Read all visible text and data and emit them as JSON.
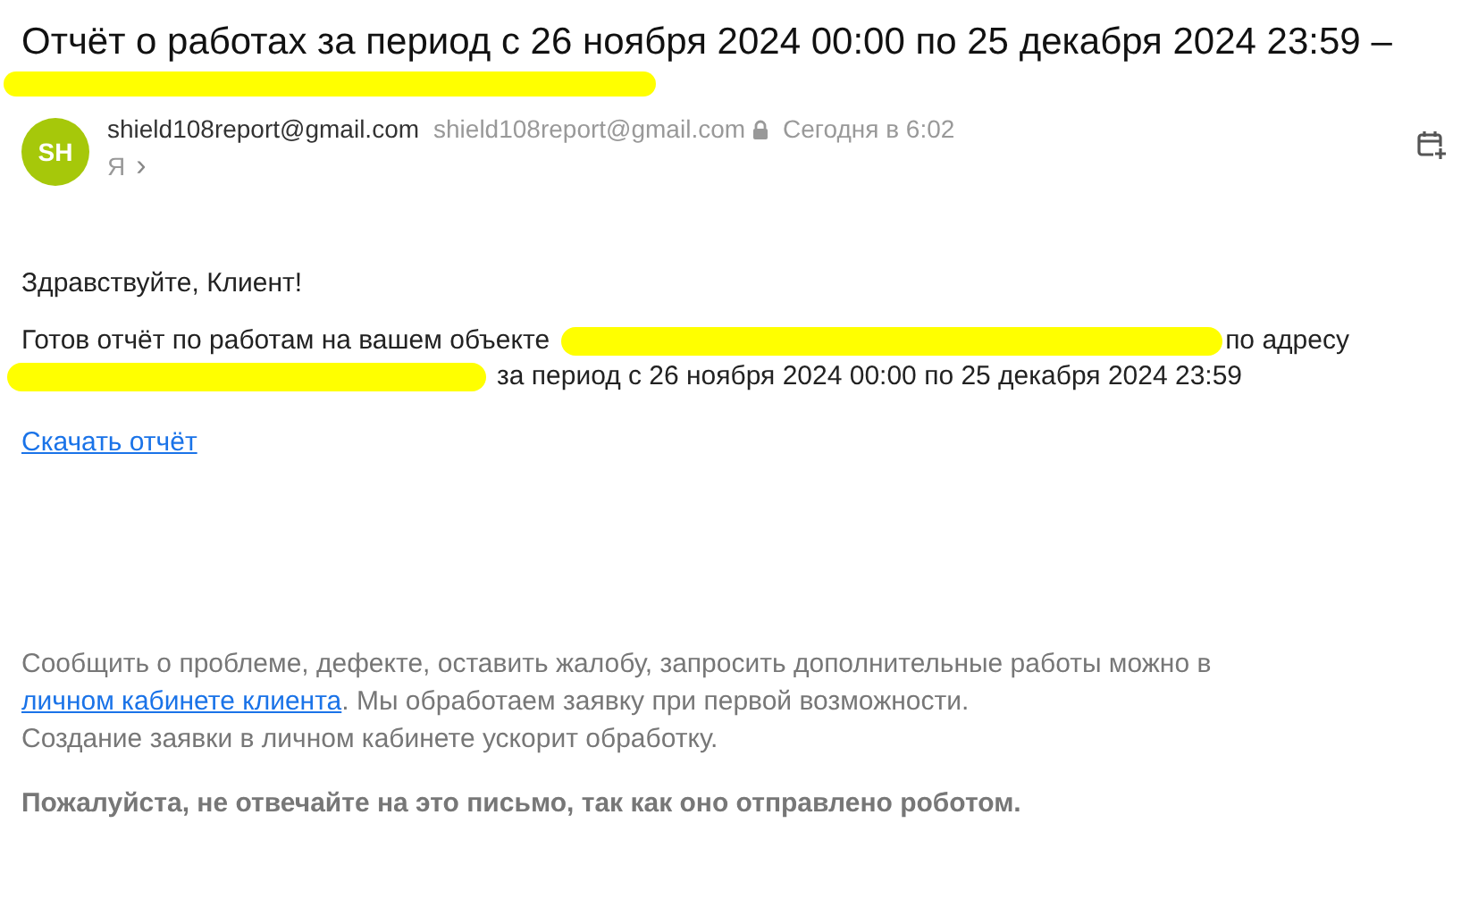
{
  "subject": {
    "text": "Отчёт о работах за период с 26 ноября 2024 00:00 по 25 декабря 2024 23:59 –",
    "redacted_line": true
  },
  "sender": {
    "initials": "SH",
    "name": "shield108report@gmail.com",
    "address": "shield108report@gmail.com",
    "locked": true,
    "time": "Сегодня в 6:02",
    "recipient": "Я",
    "recipient_arrow": "›"
  },
  "body": {
    "greeting": "Здравствуйте, Клиент!",
    "lines": [
      [
        {
          "kind": "text",
          "text": "Готов отчёт по работам на вашем объекте"
        },
        {
          "kind": "redaction"
        },
        {
          "kind": "text",
          "text": "по адресу"
        }
      ],
      [
        {
          "kind": "redaction"
        },
        {
          "kind": "text",
          "text": "за период с 26 ноября 2024 00:00 по 25 декабря 2024 23:59"
        }
      ]
    ],
    "download_link": "Скачать отчёт"
  },
  "footer": {
    "before": "Сообщить о проблеме, дефекте, оставить жалобу, запросить дополнительные работы можно в",
    "link": "личном кабинете клиента",
    "after": ". Мы обработаем заявку при первой возможности.",
    "note": "Создание заявки в личном кабинете ускорит обработку.",
    "notice": "Пожалуйста, не отвечайте на это письмо, так как оно отправлено роботом."
  }
}
